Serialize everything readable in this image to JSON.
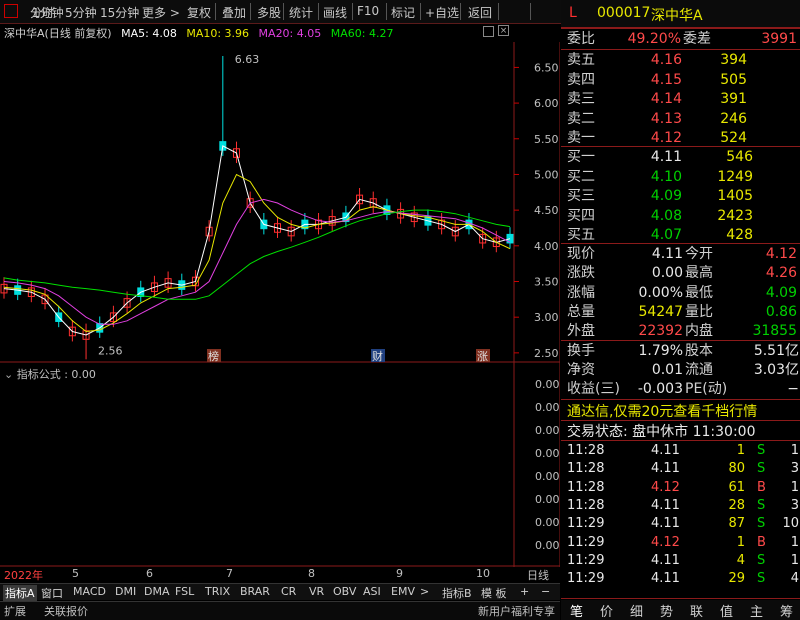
{
  "toolbar": {
    "items": [
      "分时",
      "1分钟",
      "5分钟",
      "15分钟",
      "更多",
      "复权",
      "叠加",
      "多股",
      "统计",
      "画线",
      "F10",
      "标记",
      "+自选",
      "返回"
    ]
  },
  "legend": {
    "stock": "深中华A(日线 前复权)",
    "ma5": "MA5: 4.08",
    "ma10": "MA10: 3.96",
    "ma20": "MA20: 4.05",
    "ma60": "MA60: 4.27"
  },
  "colors": {
    "ma5": "#ffffff",
    "ma10": "#e8e800",
    "ma20": "#e040e0",
    "ma60": "#00e000",
    "up": "#ff3030",
    "down": "#00e0e0",
    "border": "#8b1a1a"
  },
  "chart_data": {
    "type": "line",
    "title": "深中华A(日线 前复权)",
    "y_ticks": [
      "6.50",
      "6.00",
      "5.50",
      "5.00",
      "4.50",
      "4.00",
      "3.50",
      "3.00",
      "2.50"
    ],
    "ylim": [
      2.4,
      6.8
    ],
    "high_label": "6.63",
    "low_label": "2.56",
    "markers": [
      "榜",
      "财",
      "涨"
    ],
    "series": [
      {
        "name": "MA5",
        "values": [
          3.4,
          3.38,
          3.35,
          3.25,
          3.0,
          2.8,
          2.75,
          2.85,
          3.0,
          3.2,
          3.35,
          3.42,
          3.48,
          3.45,
          3.5,
          4.2,
          5.4,
          5.3,
          4.6,
          4.3,
          4.25,
          4.2,
          4.3,
          4.3,
          4.35,
          4.4,
          4.65,
          4.6,
          4.5,
          4.45,
          4.4,
          4.35,
          4.3,
          4.2,
          4.3,
          4.1,
          4.05,
          4.1
        ]
      },
      {
        "name": "MA10",
        "values": [
          3.42,
          3.4,
          3.38,
          3.32,
          3.15,
          2.95,
          2.8,
          2.82,
          2.92,
          3.05,
          3.2,
          3.3,
          3.4,
          3.42,
          3.45,
          3.8,
          4.6,
          5.0,
          4.9,
          4.6,
          4.4,
          4.3,
          4.25,
          4.3,
          4.32,
          4.35,
          4.5,
          4.55,
          4.5,
          4.45,
          4.42,
          4.4,
          4.35,
          4.3,
          4.3,
          4.2,
          4.05,
          3.96
        ]
      },
      {
        "name": "MA20",
        "values": [
          3.5,
          3.48,
          3.45,
          3.4,
          3.3,
          3.15,
          3.0,
          2.9,
          2.9,
          2.95,
          3.05,
          3.15,
          3.25,
          3.3,
          3.35,
          3.5,
          3.9,
          4.3,
          4.6,
          4.65,
          4.6,
          4.5,
          4.42,
          4.35,
          4.33,
          4.35,
          4.4,
          4.45,
          4.48,
          4.46,
          4.44,
          4.42,
          4.4,
          4.38,
          4.32,
          4.25,
          4.15,
          4.05
        ]
      },
      {
        "name": "MA60",
        "values": [
          3.55,
          3.52,
          3.5,
          3.48,
          3.45,
          3.42,
          3.4,
          3.38,
          3.35,
          3.32,
          3.3,
          3.28,
          3.25,
          3.25,
          3.25,
          3.3,
          3.45,
          3.6,
          3.75,
          3.85,
          3.92,
          3.98,
          4.05,
          4.12,
          4.2,
          4.28,
          4.35,
          4.4,
          4.45,
          4.48,
          4.5,
          4.5,
          4.48,
          4.45,
          4.4,
          4.35,
          4.3,
          4.27
        ]
      }
    ]
  },
  "indicator": {
    "label": "指标公式 : 0.00",
    "values": [
      "0.00",
      "0.00",
      "0.00",
      "0.00",
      "0.00",
      "0.00",
      "0.00",
      "0.00"
    ]
  },
  "time_axis": {
    "labels": [
      "2022年",
      "5",
      "6",
      "7",
      "8",
      "9",
      "10"
    ],
    "right": "日线"
  },
  "tabs": [
    "指标A",
    "窗口",
    "MACD",
    "DMI",
    "DMA",
    "FSL",
    "TRIX",
    "BRAR",
    "CR",
    "VR",
    "OBV",
    "ASI",
    "EMV",
    ">",
    "指标B",
    "模 板",
    "+",
    "−"
  ],
  "bottom": {
    "left1": "扩展",
    "left2": "关联报价",
    "right": "新用户福利专享"
  },
  "quote": {
    "code": "000017",
    "name": "深中华A",
    "flag": "L",
    "wb_label": "委比",
    "wb": "49.20%",
    "wc_label": "委差",
    "wc": "3991",
    "sells": [
      {
        "l": "卖五",
        "p": "4.16",
        "v": "394"
      },
      {
        "l": "卖四",
        "p": "4.15",
        "v": "505"
      },
      {
        "l": "卖三",
        "p": "4.14",
        "v": "391"
      },
      {
        "l": "卖二",
        "p": "4.13",
        "v": "246"
      },
      {
        "l": "卖一",
        "p": "4.12",
        "v": "524"
      }
    ],
    "buys": [
      {
        "l": "买一",
        "p": "4.11",
        "v": "546",
        "c": "wht"
      },
      {
        "l": "买二",
        "p": "4.10",
        "v": "1249",
        "c": "grn"
      },
      {
        "l": "买三",
        "p": "4.09",
        "v": "1405",
        "c": "grn"
      },
      {
        "l": "买四",
        "p": "4.08",
        "v": "2423",
        "c": "grn"
      },
      {
        "l": "买五",
        "p": "4.07",
        "v": "428",
        "c": "grn"
      }
    ],
    "stats": [
      {
        "l1": "现价",
        "v1": "4.11",
        "c1": "wht",
        "l2": "今开",
        "v2": "4.12",
        "c2": "red"
      },
      {
        "l1": "涨跌",
        "v1": "0.00",
        "c1": "wht",
        "l2": "最高",
        "v2": "4.26",
        "c2": "red"
      },
      {
        "l1": "涨幅",
        "v1": "0.00%",
        "c1": "wht",
        "l2": "最低",
        "v2": "4.09",
        "c2": "grn"
      },
      {
        "l1": "总量",
        "v1": "54247",
        "c1": "yel",
        "l2": "量比",
        "v2": "0.86",
        "c2": "grn"
      },
      {
        "l1": "外盘",
        "v1": "22392",
        "c1": "red",
        "l2": "内盘",
        "v2": "31855",
        "c2": "grn"
      }
    ],
    "stats2": [
      {
        "l1": "换手",
        "v1": "1.79%",
        "l2": "股本",
        "v2": "5.51亿"
      },
      {
        "l1": "净资",
        "v1": "0.01",
        "l2": "流通",
        "v2": "3.03亿"
      },
      {
        "l1": "收益(三)",
        "v1": "-0.003",
        "l2": "PE(动)",
        "v2": "−"
      }
    ],
    "promo": "通达信,仅需20元查看千档行情",
    "status": "交易状态: 盘中休市 11:30:00",
    "ticks": [
      {
        "t": "11:28",
        "p": "4.11",
        "pc": "wht",
        "v": "1",
        "bs": "S",
        "n": "1"
      },
      {
        "t": "11:28",
        "p": "4.11",
        "pc": "wht",
        "v": "80",
        "bs": "S",
        "n": "3"
      },
      {
        "t": "11:28",
        "p": "4.12",
        "pc": "red",
        "v": "61",
        "bs": "B",
        "n": "1"
      },
      {
        "t": "11:28",
        "p": "4.11",
        "pc": "wht",
        "v": "28",
        "bs": "S",
        "n": "3"
      },
      {
        "t": "11:29",
        "p": "4.11",
        "pc": "wht",
        "v": "87",
        "bs": "S",
        "n": "10"
      },
      {
        "t": "11:29",
        "p": "4.12",
        "pc": "red",
        "v": "1",
        "bs": "B",
        "n": "1"
      },
      {
        "t": "11:29",
        "p": "4.11",
        "pc": "wht",
        "v": "4",
        "bs": "S",
        "n": "1"
      },
      {
        "t": "11:29",
        "p": "4.11",
        "pc": "wht",
        "v": "29",
        "bs": "S",
        "n": "4"
      }
    ],
    "btabs": [
      "笔",
      "价",
      "细",
      "势",
      "联",
      "值",
      "主",
      "筹"
    ]
  }
}
